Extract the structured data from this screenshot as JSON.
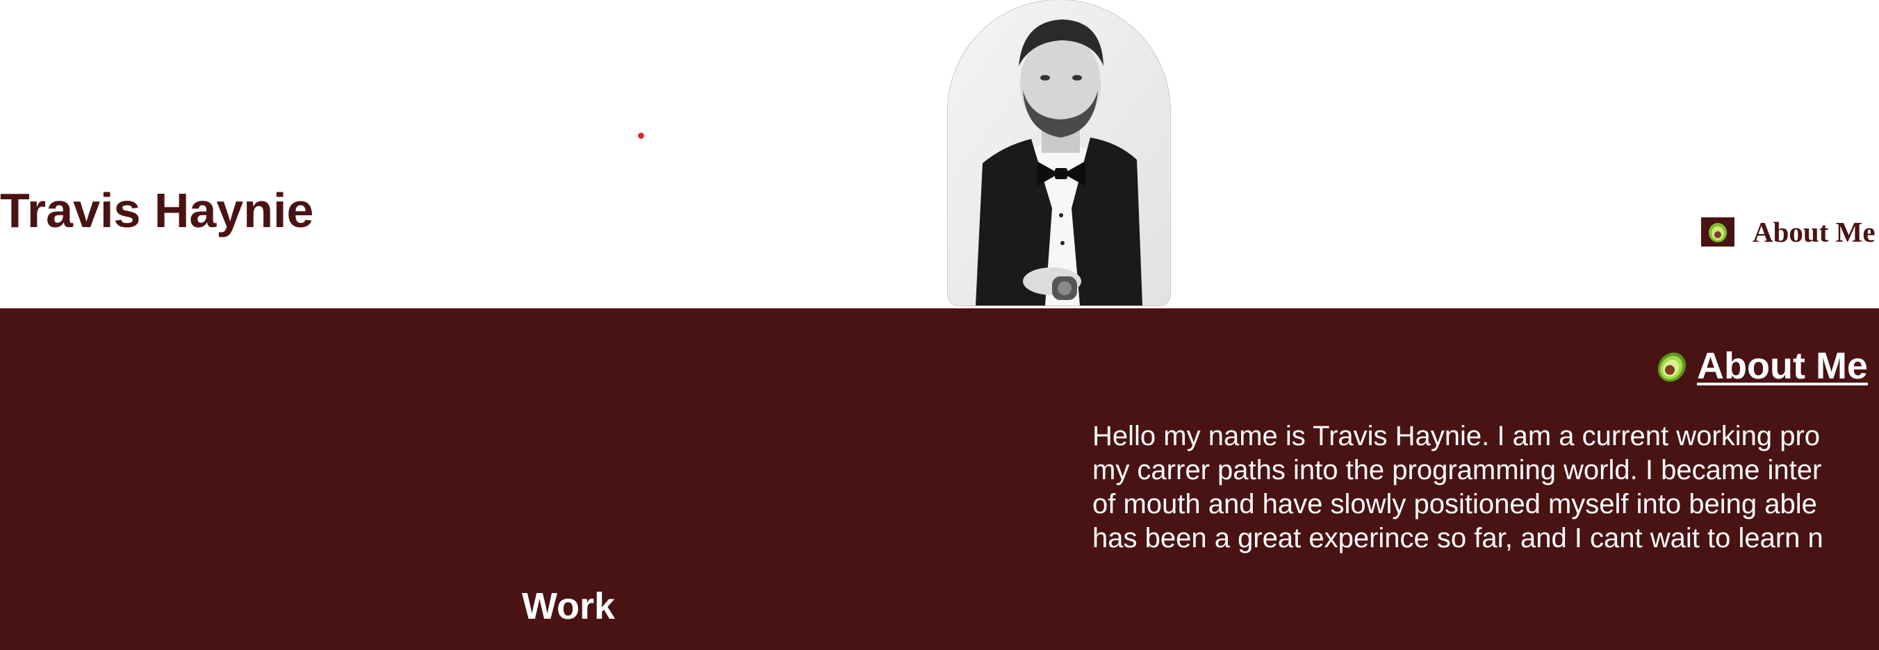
{
  "header": {
    "title": "Travis Haynie",
    "nav": {
      "items": [
        {
          "label": "About Me",
          "icon": "avocado-icon"
        }
      ]
    },
    "portrait_icon": "profile-photo"
  },
  "about": {
    "heading": "About Me",
    "heading_icon": "avocado-icon",
    "lines": [
      "Hello my name is Travis Haynie. I am a current working pro",
      "my carrer paths into the programming world. I became inter",
      "of mouth and have slowly positioned myself into being able",
      "has been a great experince so far, and I cant wait to learn n"
    ]
  },
  "work": {
    "heading": "Work"
  },
  "colors": {
    "maroon": "#491313",
    "title_text": "#4a1313",
    "accent_dot": "#e12b2b",
    "avocado_green": "#7fc02c",
    "avocado_pit": "#7a3f22"
  }
}
